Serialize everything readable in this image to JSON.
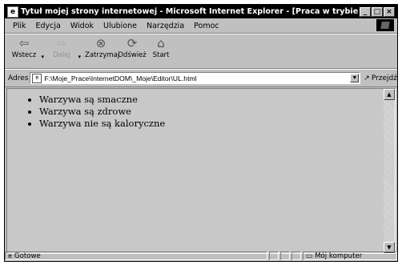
{
  "window": {
    "title": "Tytuł mojej strony internetowej - Microsoft Internet Explorer - [Praca w trybie offline]",
    "buttons": {
      "minimize": "_",
      "maximize": "□",
      "close": "×"
    }
  },
  "menu": {
    "items": [
      "Plik",
      "Edycja",
      "Widok",
      "Ulubione",
      "Narzędzia",
      "Pomoc"
    ]
  },
  "toolbar": {
    "back": "Wstecz",
    "forward": "Dalej",
    "stop": "Zatrzymaj",
    "refresh": "Odśwież",
    "home": "Start"
  },
  "address": {
    "label": "Adres",
    "value": "F:\\Moje_Prace\\InternetDOM\\_Moje\\Editor\\UL.html",
    "go": "Przejdź"
  },
  "content": {
    "list": [
      "Warzywa są smaczne",
      "Warzywa są zdrowe",
      "Warzywa nie są kaloryczne"
    ]
  },
  "status": {
    "text": "Gotowe",
    "zone": "Mój komputer"
  }
}
